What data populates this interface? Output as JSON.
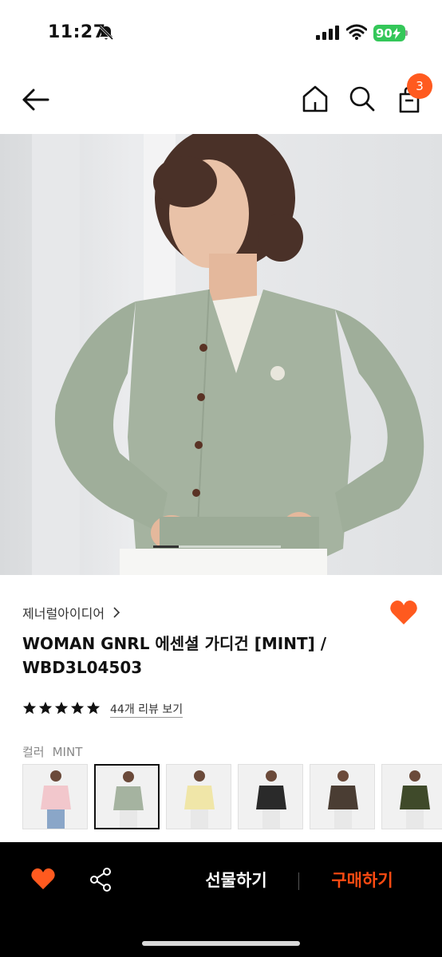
{
  "status_bar": {
    "time": "11:27",
    "battery": "90",
    "icons": [
      "bell-slash-icon",
      "signal-icon",
      "wifi-icon",
      "battery-icon"
    ]
  },
  "nav": {
    "icons": [
      "back-arrow-icon",
      "home-icon",
      "search-icon",
      "shopping-bag-icon"
    ],
    "cart_count": "3"
  },
  "hero": {
    "carousel_progress": 0.2,
    "colors": {
      "cardigan": "#a5b3a0",
      "background": "#e3e5e7"
    }
  },
  "product": {
    "brand": "제너럴아이디어",
    "title_line1": "WOMAN GNRL 에센셜 가디건 [MINT] /",
    "title_line2": "WBD3L04503",
    "rating": 5,
    "review_link": "44개 리뷰 보기",
    "color_label": "컬러",
    "color_value": "MINT",
    "swatches": [
      {
        "color": "#f2c7cc",
        "selected": false
      },
      {
        "color": "#a5b3a0",
        "selected": true
      },
      {
        "color": "#f0e6a8",
        "selected": false
      },
      {
        "color": "#2a2a2a",
        "selected": false
      },
      {
        "color": "#4a3d33",
        "selected": false
      },
      {
        "color": "#3f4a2a",
        "selected": false
      }
    ]
  },
  "bottom_bar": {
    "gift_label": "선물하기",
    "buy_label": "구매하기",
    "accent_color": "#ff4b12"
  }
}
